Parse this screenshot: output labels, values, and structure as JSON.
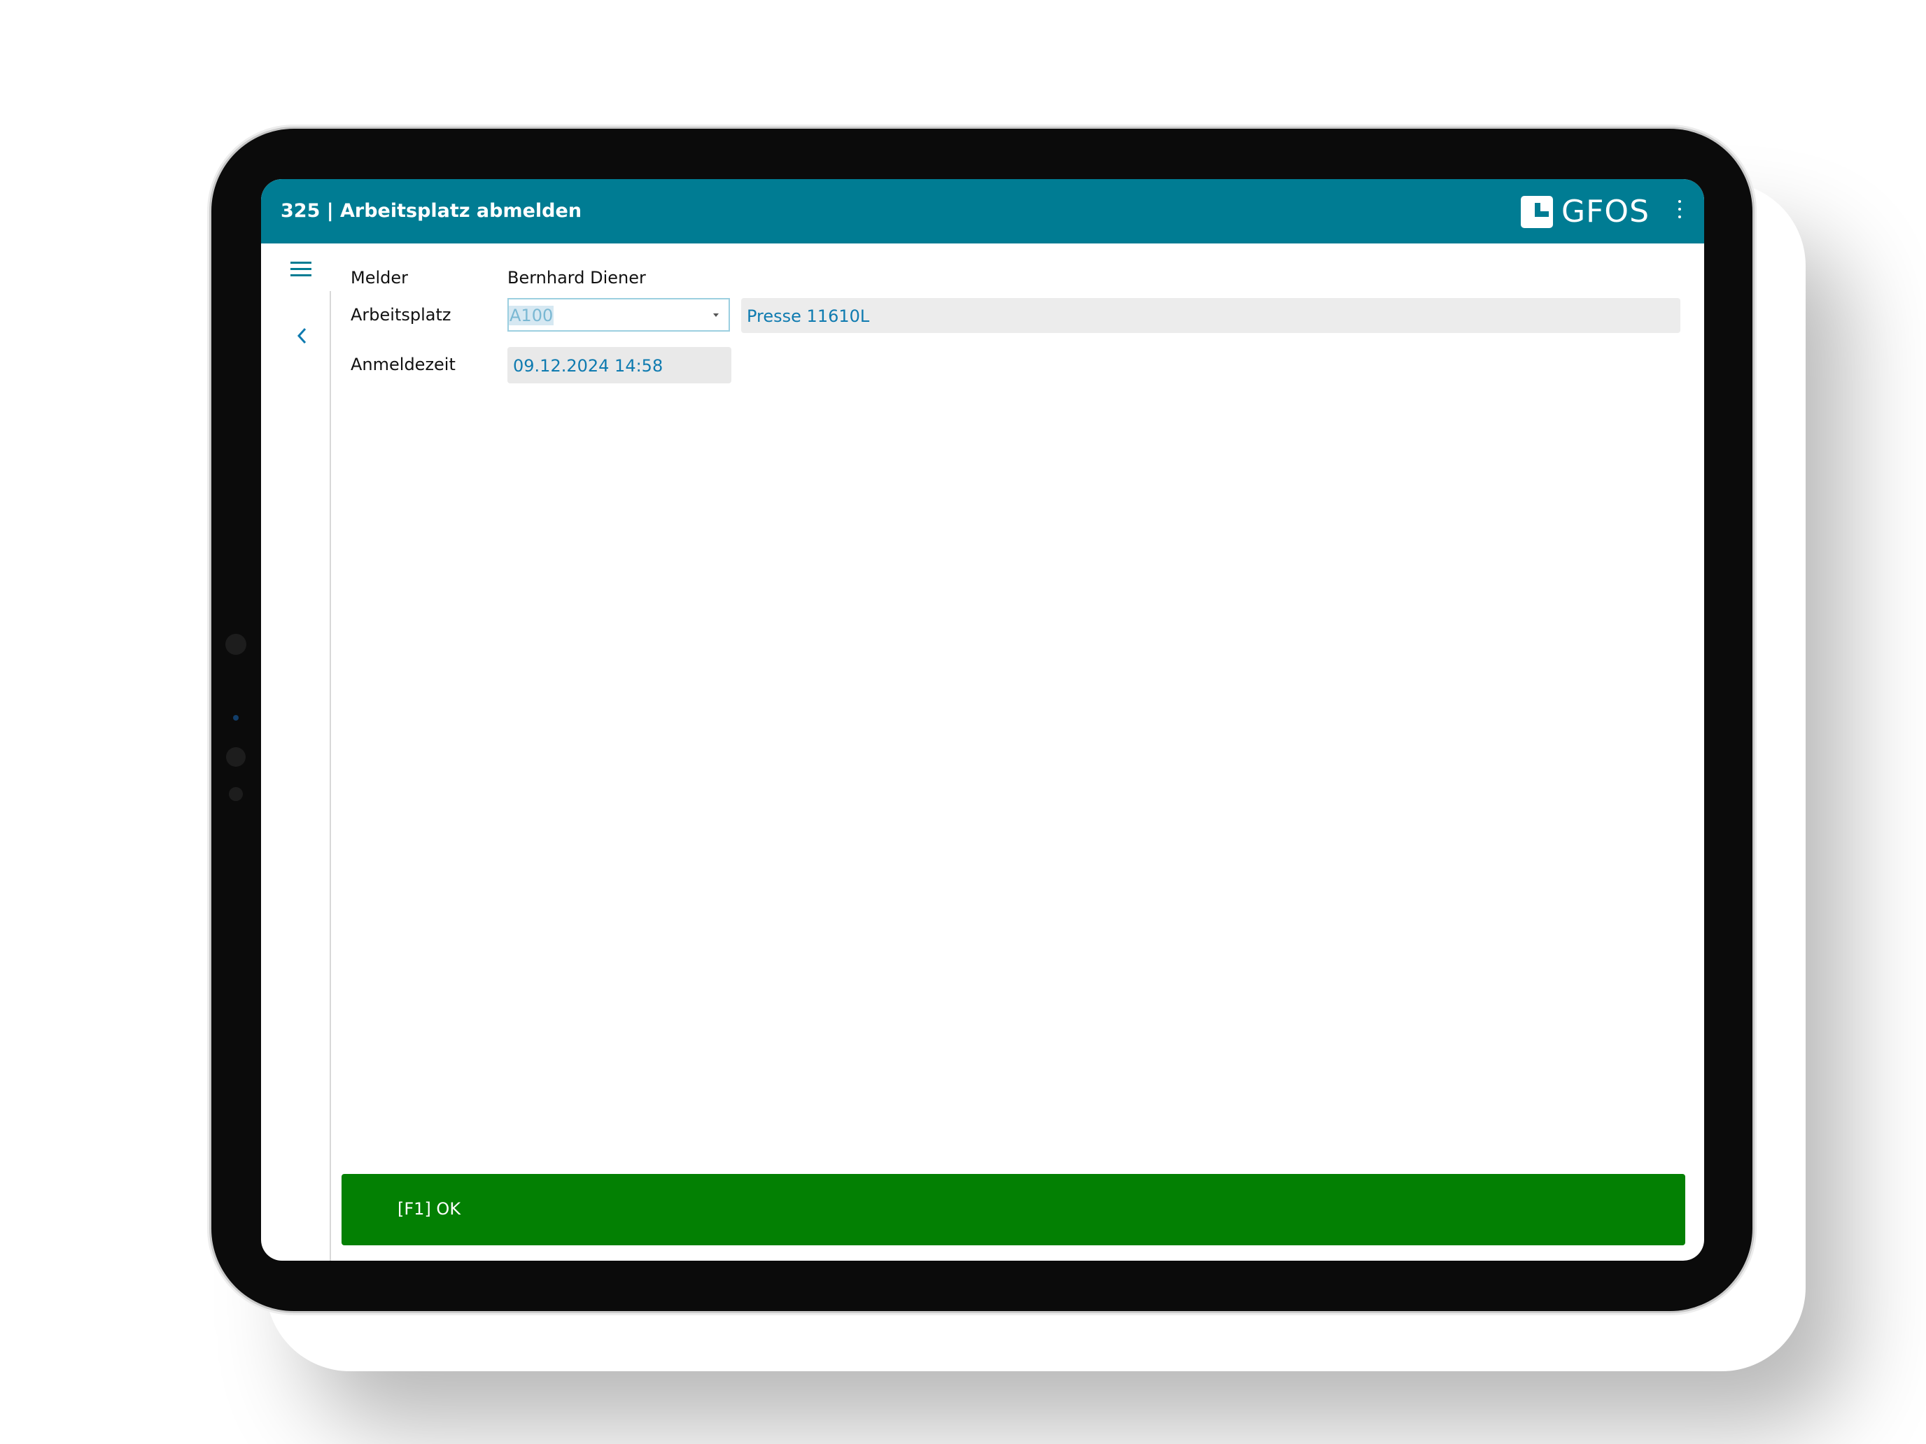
{
  "app": {
    "title": "325 | Arbeitsplatz abmelden",
    "brand": "GFOS",
    "accent_color": "#007c93"
  },
  "icons": {
    "menu": "hamburger-menu-icon",
    "back": "chevron-left-icon",
    "more": "more-vertical-icon",
    "dropdown": "caret-down-icon"
  },
  "form": {
    "melder": {
      "label": "Melder",
      "value": "Bernhard Diener"
    },
    "arbeitsplatz": {
      "label": "Arbeitsplatz",
      "value": "A100",
      "description": "Presse 11610L"
    },
    "anmeldezeit": {
      "label": "Anmeldezeit",
      "value": "09.12.2024 14:58"
    }
  },
  "actions": {
    "ok_label": "[F1] OK",
    "ok_color": "#038003"
  }
}
